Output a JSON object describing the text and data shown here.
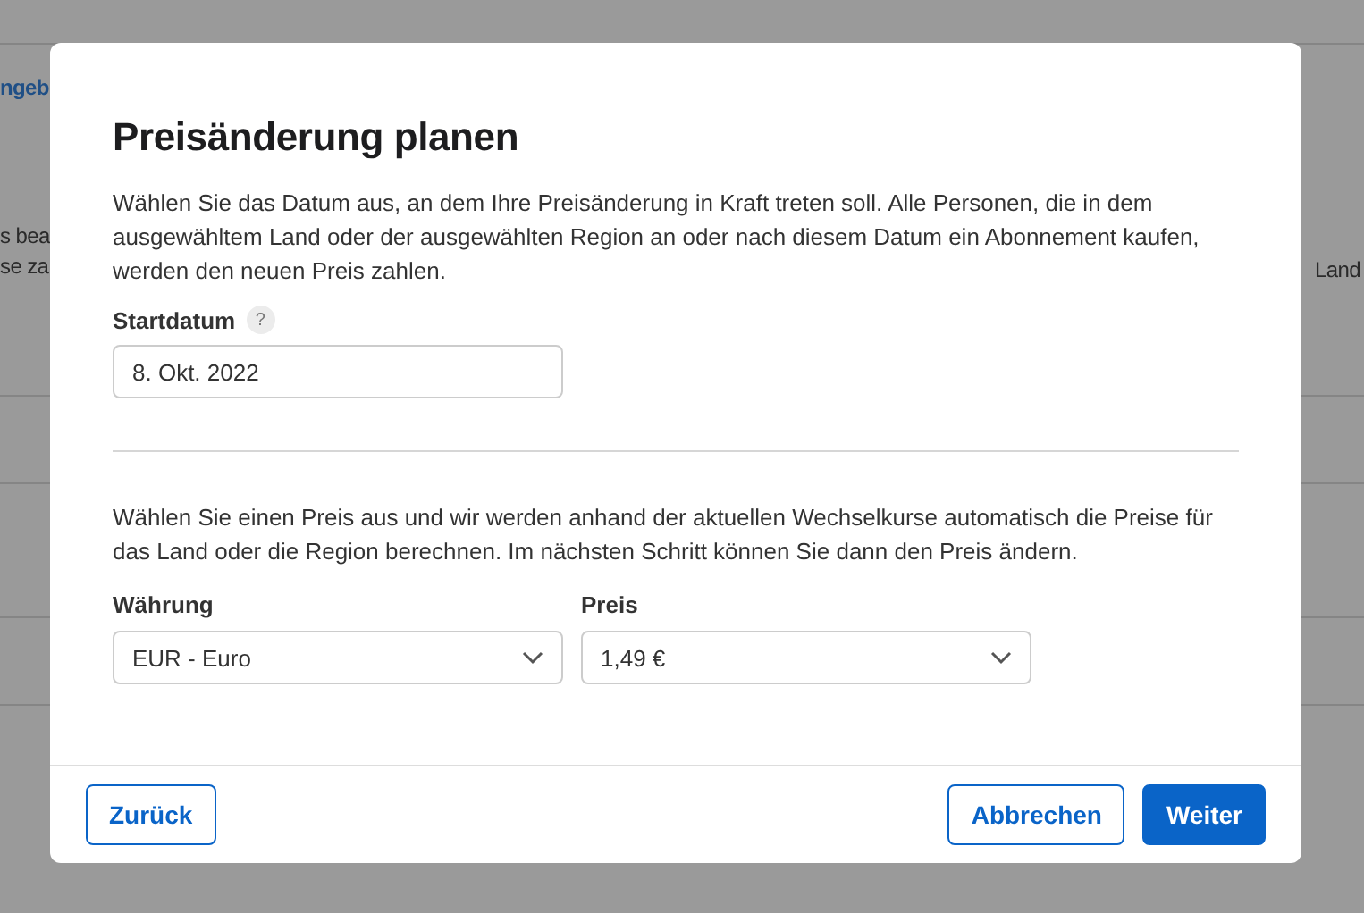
{
  "background": {
    "link": "ngeb",
    "left_lines": [
      "s bea",
      "se za"
    ],
    "right_text": "Land"
  },
  "dialog": {
    "title": "Preisänderung planen",
    "intro": "Wählen Sie das Datum aus, an dem Ihre Preisänderung in Kraft treten soll. Alle Personen, die in dem ausgewähltem Land oder der ausgewählten Region an oder nach diesem Datum ein Abonnement kaufen, werden den neuen Preis zahlen.",
    "start_date": {
      "label": "Startdatum",
      "help": "?",
      "value": "8. Okt. 2022"
    },
    "price_intro": "Wählen Sie einen Preis aus und wir werden anhand der aktuellen Wechselkurse automatisch die Preise für das Land oder die Region berechnen. Im nächsten Schritt können Sie dann den Preis ändern.",
    "selects": [
      {
        "label": "Währung",
        "value": "EUR - Euro"
      },
      {
        "label": "Preis",
        "value": "1,49 €"
      }
    ],
    "buttons": [
      {
        "label": "Zurück",
        "kind": "secondary"
      },
      {
        "label": "Abbrechen",
        "kind": "secondary"
      },
      {
        "label": "Weiter",
        "kind": "primary"
      }
    ]
  }
}
